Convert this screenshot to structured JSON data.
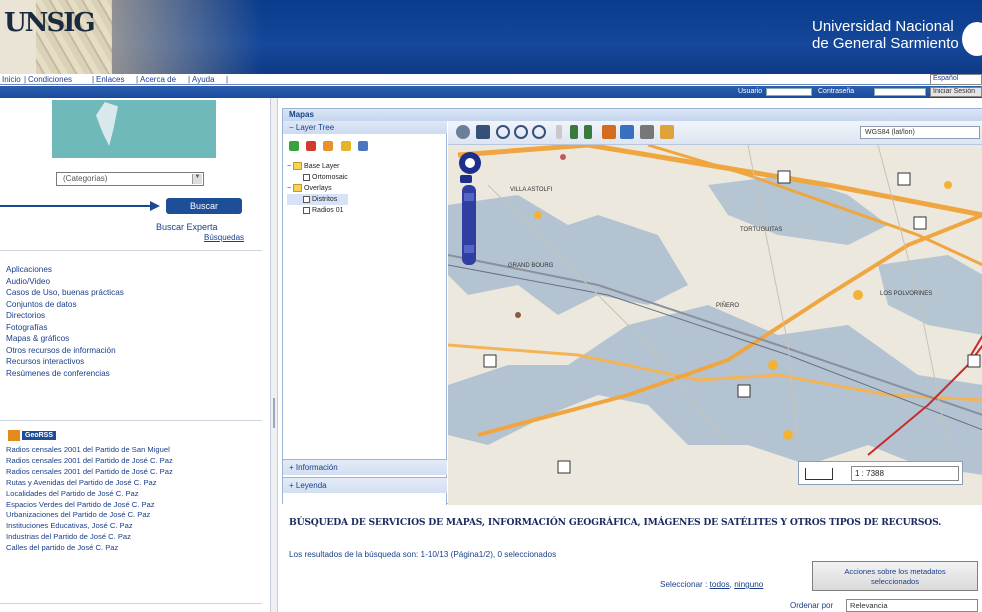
{
  "header": {
    "university_line1": "Universidad Nacional",
    "university_line2": "de General Sarmiento",
    "logo_text": "UNSIG"
  },
  "navbar": {
    "items": [
      "Inicio",
      "Condiciones",
      "Enlaces",
      "Acerca de",
      "Ayuda"
    ],
    "language": "Español"
  },
  "login": {
    "user_label": "Usuario",
    "password_label": "Contraseña",
    "button": "Iniciar Sesión"
  },
  "sidebar": {
    "category_select": "(Categorías)",
    "search_button": "Buscar",
    "advanced_search": "Buscar Experta",
    "advanced_help": "Búsquedas",
    "categories": [
      "Aplicaciones",
      "Audio/Video",
      "Casos de Uso, buenas prácticas",
      "Conjuntos de datos",
      "Directorios",
      "Fotografías",
      "Mapas & gráficos",
      "Otros recursos de información",
      "Recursos interactivos",
      "Resúmenes de conferencias"
    ],
    "results_badge": "GeoRSS",
    "results": [
      "Radios censales 2001 del Partido de San Miguel",
      "Radios censales 2001 del Partido de José C. Paz",
      "Radios censales 2001 del Partido de José C. Paz",
      "Rutas y Avenidas del Partido de José C. Paz",
      "Localidades del Partido de José C. Paz",
      "Espacios Verdes del Partido de José C. Paz",
      "Urbanizaciones del Partido de José C. Paz",
      "Instituciones Educativas, José C. Paz",
      "Industrias del Partido de José C. Paz",
      "Calles del partido de José C. Paz"
    ]
  },
  "maps": {
    "title": "Mapas",
    "layer_tree_title": "Layer Tree",
    "tree": {
      "base_layer": "Base Layer",
      "base_item": "Ortomosaic",
      "overlays": "Overlays",
      "overlay_1": "Distritos",
      "overlay_2": "Radios 01"
    },
    "legend_tab_1": "Información",
    "legend_tab_2": "Leyenda",
    "projection": "WGS84 (lat/lon)",
    "scale": "1 : 7388",
    "map_labels": [
      "VILLA ASTOLFI",
      "TORTUGUITAS",
      "LOS POLVORINES",
      "GRAND BOURG",
      "PIÑERO"
    ]
  },
  "results": {
    "title": "BÚSQUEDA DE SERVICIOS DE MAPAS, INFORMACIÓN GEOGRÁFICA, IMÁGENES DE SATÉLITES Y OTROS TIPOS DE RECURSOS.",
    "count": "Los resultados de la búsqueda son:   1-10/13   (Página1/2),   0 seleccionados",
    "select_label": "Seleccionar :",
    "select_all": "todos",
    "select_none": "ninguno",
    "meta_button_line1": "Acciones sobre los metadatos",
    "meta_button_line2": "seleccionados",
    "order_label": "Ordenar por",
    "order_value": "Relevancia"
  },
  "colors": {
    "header_blue": "#0a3b8c",
    "link_blue": "#1a3f8a",
    "road_orange": "#f0a640",
    "urban_blue": "#a9bcd0"
  }
}
